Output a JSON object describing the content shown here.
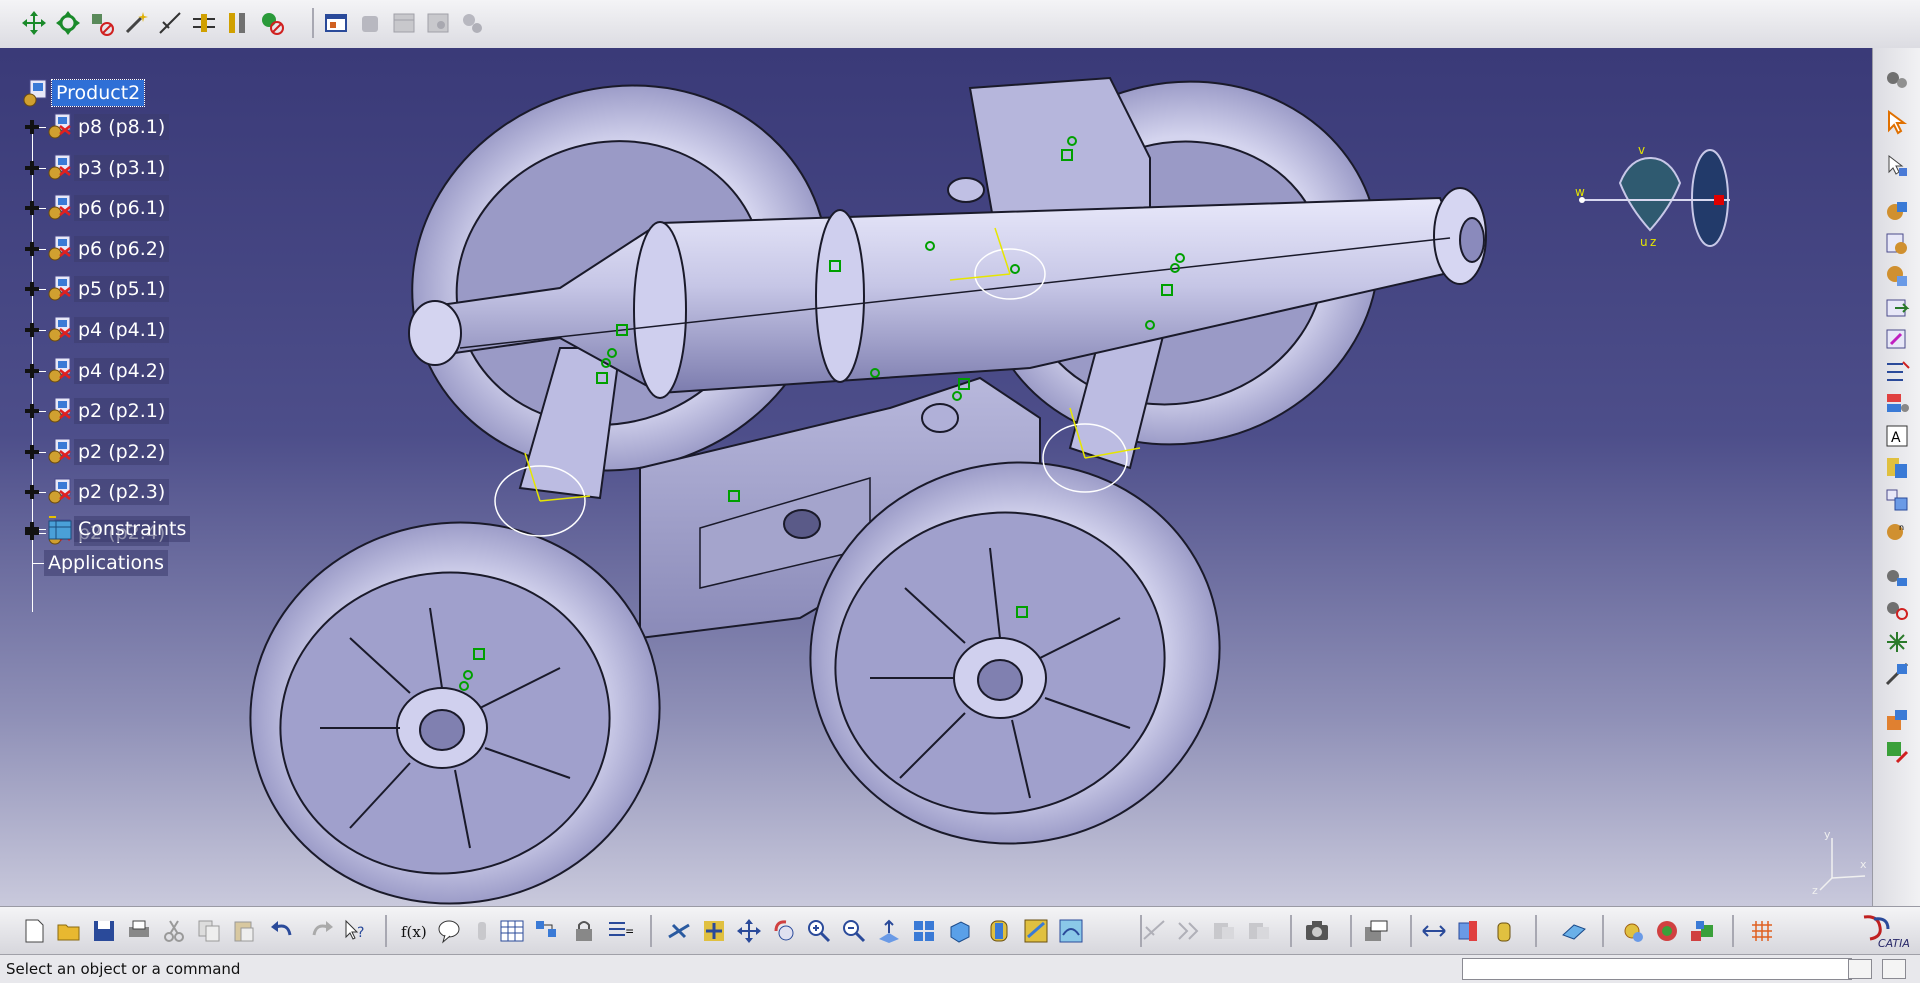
{
  "spec_tree": {
    "root": "Product2",
    "items": [
      {
        "label": "p8 (p8.1)"
      },
      {
        "label": "p3 (p3.1)"
      },
      {
        "label": "p6 (p6.1)"
      },
      {
        "label": "p6 (p6.2)"
      },
      {
        "label": "p5 (p5.1)"
      },
      {
        "label": "p4 (p4.1)"
      },
      {
        "label": "p4 (p4.2)"
      },
      {
        "label": "p2 (p2.1)"
      },
      {
        "label": "p2 (p2.2)"
      },
      {
        "label": "p2 (p2.3)"
      },
      {
        "label": "p2 (p2.4)"
      }
    ],
    "constraints": "Constraints",
    "applications": "Applications"
  },
  "compass": {
    "u": "u",
    "v": "v",
    "w": "w",
    "z": "z"
  },
  "axis_triad": {
    "x": "x",
    "y": "y",
    "z": "z"
  },
  "status": {
    "message": "Select an object or a command",
    "command_input": ""
  },
  "brand": {
    "logo_text": "CATIA"
  },
  "colors": {
    "viewport_top": "#3a3a78",
    "viewport_bottom": "#c9c9dc",
    "part_fill": "#c8c8e8",
    "selection": "#2f6fd6",
    "constraint_green": "#00a000",
    "axis_yellow": "#e6e600"
  }
}
